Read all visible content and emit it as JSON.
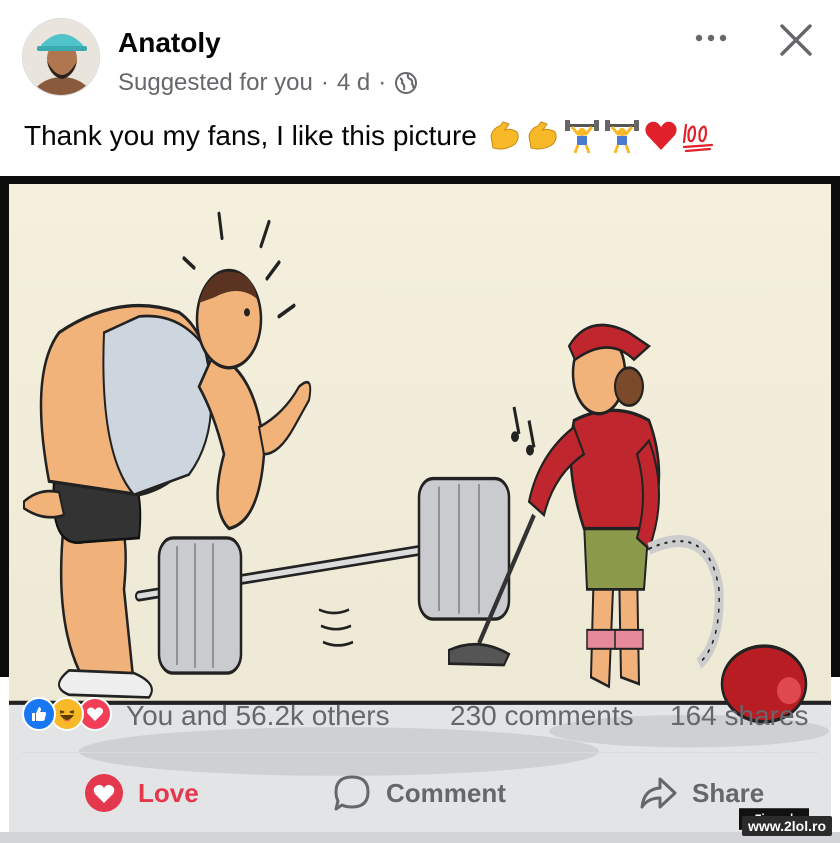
{
  "post": {
    "author": "Anatoly",
    "context": "Suggested for you",
    "time": "4 d",
    "caption": "Thank you my fans, I like this picture",
    "caption_emojis": [
      "flexed-biceps",
      "flexed-biceps",
      "weight-lifter",
      "weight-lifter",
      "red-heart",
      "hundred-points"
    ],
    "image_watermark": "Zieer.nl"
  },
  "stats": {
    "reaction_types": [
      "like",
      "haha",
      "love"
    ],
    "reaction_summary": "You and 56.2k others",
    "comments": "230 comments",
    "shares": "164 shares"
  },
  "actions": {
    "love": "Love",
    "comment": "Comment",
    "share": "Share"
  },
  "site_watermark": "www.2lol.ro",
  "colors": {
    "love_red": "#e4384f",
    "like_blue": "#1877f2",
    "haha_yellow": "#f7b928",
    "secondary_text": "#65676b"
  }
}
